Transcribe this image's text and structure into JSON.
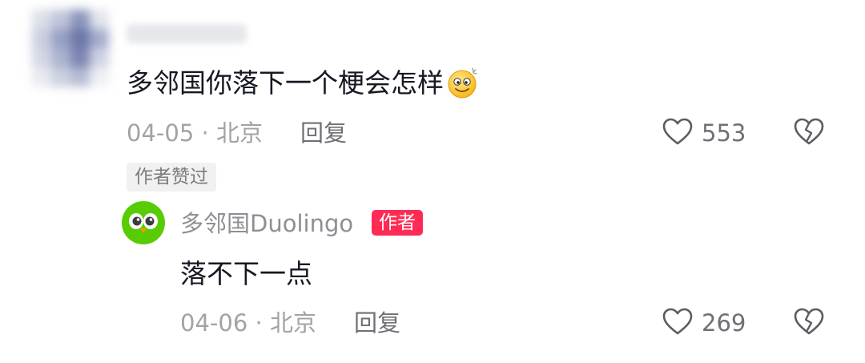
{
  "comment": {
    "text": "多邻国你落下一个梗会怎样",
    "emoji": "clown-smile-emoji",
    "date": "04-05",
    "separator": "·",
    "location": "北京",
    "reply_label": "回复",
    "likes": "553",
    "author_liked_badge": "作者赞过"
  },
  "reply": {
    "username": "多邻国Duolingo",
    "author_badge": "作者",
    "text": "落不下一点",
    "date": "04-06",
    "separator": "·",
    "location": "北京",
    "reply_label": "回复",
    "likes": "269"
  },
  "colors": {
    "text_primary": "#161823",
    "text_meta": "#a2a3a7",
    "author_badge_bg": "#fe2c55",
    "duolingo_green": "#58cc02"
  },
  "icons": [
    "heart-outline-icon",
    "broken-heart-icon",
    "duolingo-owl-avatar"
  ]
}
